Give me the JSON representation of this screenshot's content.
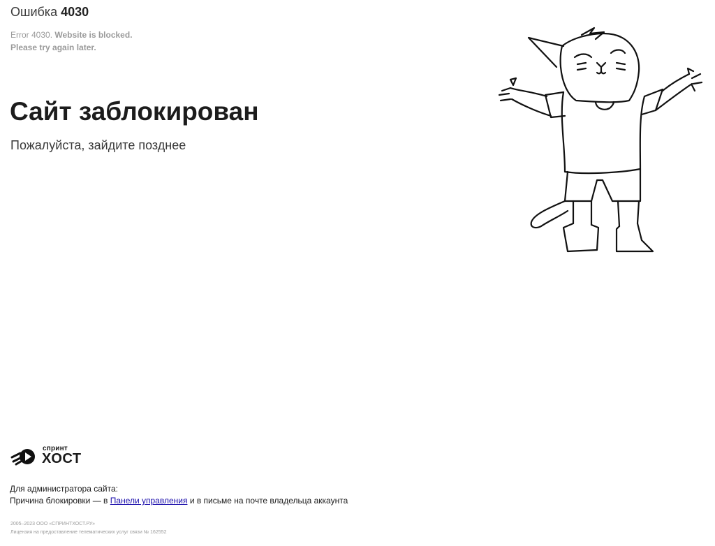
{
  "error": {
    "prefix": "Ошибка",
    "code": "4030",
    "en_code": "Error 4030.",
    "en_blocked": "Website is blocked.",
    "en_retry": "Please try again later."
  },
  "main": {
    "title": "Сайт заблокирован",
    "subtitle": "Пожалуйста, зайдите позднее"
  },
  "brand": {
    "top": "спринт",
    "bottom": "ХОСТ"
  },
  "admin": {
    "heading": "Для администратора сайта:",
    "reason_prefix": "Причина блокировки — в",
    "link_text": "Панели управления",
    "reason_suffix": "и в письме на почте владельца аккаунта"
  },
  "footer": {
    "copyright": "2005–2023 ООО «СПРИНТХОСТ.РУ»",
    "license": "Лицензия на предоставление телематических услуг связи № 162552"
  },
  "icons": {
    "illustration": "shrugging-cat-illustration",
    "logo": "sprinthost-logo-icon"
  },
  "colors": {
    "text": "#1a1a1a",
    "muted": "#9a9a9a",
    "link": "#1a0dab"
  }
}
